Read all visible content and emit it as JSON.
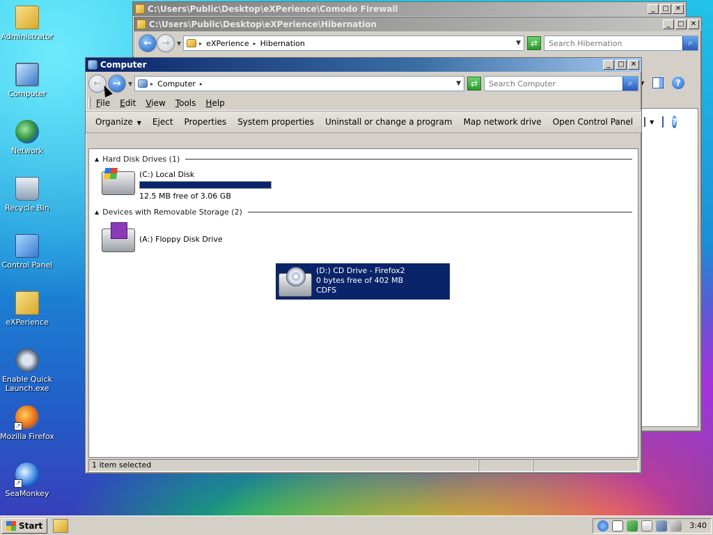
{
  "desktop": {
    "icons": [
      {
        "label": "Administrator",
        "icon": "folder-icon"
      },
      {
        "label": "Computer",
        "icon": "computer-icon"
      },
      {
        "label": "Network",
        "icon": "network-icon"
      },
      {
        "label": "Recycle Bin",
        "icon": "recycle-bin-icon"
      },
      {
        "label": "Control Panel",
        "icon": "control-panel-icon"
      },
      {
        "label": "eXPerience",
        "icon": "folder-icon"
      },
      {
        "label": "Enable Quick Launch.exe",
        "icon": "quick-launch-icon"
      },
      {
        "label": "Mozilla Firefox",
        "icon": "firefox-icon"
      },
      {
        "label": "SeaMonkey",
        "icon": "seamonkey-icon"
      }
    ]
  },
  "back_window1": {
    "title": "C:\\Users\\Public\\Desktop\\eXPerience\\Comodo Firewall"
  },
  "back_window2": {
    "title": "C:\\Users\\Public\\Desktop\\eXPerience\\Hibernation",
    "address": {
      "crumbs": [
        "eXPerience",
        "Hibernation"
      ]
    },
    "search_placeholder": "Search Hibernation"
  },
  "main_window": {
    "title": "Computer",
    "address": {
      "crumbs": [
        "Computer"
      ]
    },
    "search_placeholder": "Search Computer",
    "menu": [
      "File",
      "Edit",
      "View",
      "Tools",
      "Help"
    ],
    "toolbar": {
      "organize": "Organize",
      "eject": "Eject",
      "properties": "Properties",
      "system_properties": "System properties",
      "uninstall": "Uninstall or change a program",
      "map_drive": "Map network drive",
      "open_cp": "Open Control Panel"
    },
    "groups": {
      "hdd_header": "Hard Disk Drives (1)",
      "removable_header": "Devices with Removable Storage (2)"
    },
    "drives": {
      "c": {
        "name": "(C:) Local Disk",
        "free": "12.5 MB free of 3.06 GB",
        "used_fraction": 0.996
      },
      "a": {
        "name": "(A:) Floppy Disk Drive"
      },
      "d": {
        "name": "(D:) CD Drive - Firefox2",
        "free": "0 bytes free of 402 MB",
        "fs": "CDFS"
      }
    },
    "status": "1 item selected"
  },
  "taskbar": {
    "start_label": "Start",
    "clock": "3:40"
  }
}
